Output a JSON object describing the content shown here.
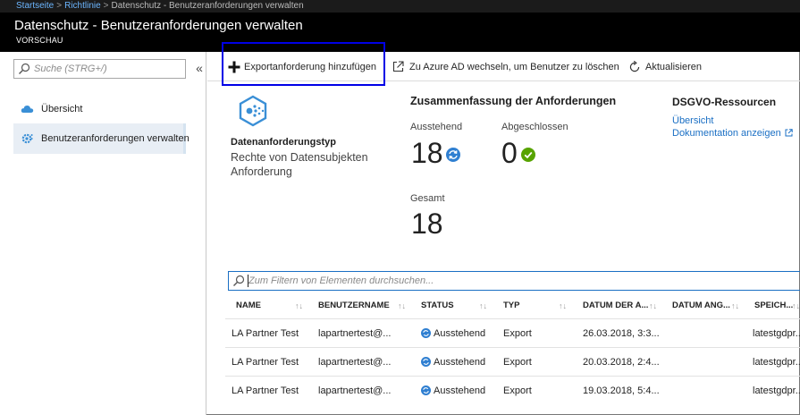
{
  "breadcrumb": {
    "items": [
      "Startseite",
      "Richtlinie",
      "Datenschutz - Benutzeranforderungen verwalten"
    ],
    "separator": ">"
  },
  "header": {
    "title": "Datenschutz - Benutzeranforderungen verwalten",
    "subtitle": "VORSCHAU"
  },
  "sidebar": {
    "search_placeholder": "Suche (STRG+/)",
    "collapse_glyph": "«",
    "items": [
      {
        "label": "Übersicht",
        "icon": "cloud-icon",
        "active": false
      },
      {
        "label": "Benutzeranforderungen verwalten",
        "icon": "gear-icon",
        "active": true
      }
    ]
  },
  "toolbar": {
    "add_export": "Exportanforderung hinzufügen",
    "switch_aad": "Zu Azure AD wechseln, um Benutzer zu löschen",
    "refresh": "Aktualisieren"
  },
  "request_type": {
    "title": "Datenanforderungstyp",
    "line1": "Rechte von Datensubjekten",
    "line2": "Anforderung"
  },
  "summary": {
    "title": "Zusammenfassung der Anforderungen",
    "pending_label": "Ausstehend",
    "pending_value": "18",
    "completed_label": "Abgeschlossen",
    "completed_value": "0",
    "total_label": "Gesamt",
    "total_value": "18"
  },
  "resources": {
    "title": "DSGVO-Ressourcen",
    "overview_link": "Übersicht",
    "docs_link": "Dokumentation anzeigen"
  },
  "filter": {
    "placeholder": "Zum Filtern von Elementen durchsuchen..."
  },
  "table": {
    "columns": [
      "NAME",
      "BENUTZERNAME",
      "STATUS",
      "TYP",
      "DATUM DER A...",
      "DATUM ANG...",
      "SPEICH..."
    ],
    "rows": [
      {
        "name": "LA Partner Test",
        "user": "lapartnertest@...",
        "status": "Ausstehend",
        "type": "Export",
        "date": "26.03.2018, 3:3...",
        "date2": "",
        "storage": "latestgdpr..."
      },
      {
        "name": "LA Partner Test",
        "user": "lapartnertest@...",
        "status": "Ausstehend",
        "type": "Export",
        "date": "20.03.2018, 2:4...",
        "date2": "",
        "storage": "latestgdpr..."
      },
      {
        "name": "LA Partner Test",
        "user": "lapartnertest@...",
        "status": "Ausstehend",
        "type": "Export",
        "date": "19.03.2018, 5:4...",
        "date2": "",
        "storage": "latestgdpr..."
      }
    ]
  },
  "colors": {
    "accent": "#1a6fc4",
    "highlight": "#0000e6",
    "success": "#57a300",
    "titlebar": "#000000",
    "breadcrumb_link": "#6cb6ff"
  }
}
